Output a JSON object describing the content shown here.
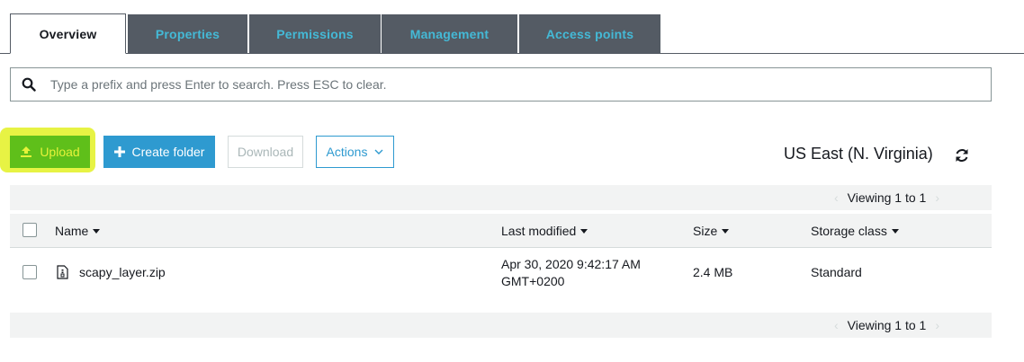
{
  "tabs": [
    {
      "label": "Overview",
      "active": true
    },
    {
      "label": "Properties"
    },
    {
      "label": "Permissions"
    },
    {
      "label": "Management"
    },
    {
      "label": "Access points"
    }
  ],
  "search": {
    "placeholder": "Type a prefix and press Enter to search. Press ESC to clear.",
    "value": ""
  },
  "toolbar": {
    "upload_label": "Upload",
    "create_folder_label": "Create folder",
    "download_label": "Download",
    "actions_label": "Actions"
  },
  "region": "US East (N. Virginia)",
  "pager": {
    "top": "Viewing 1 to 1",
    "bottom": "Viewing 1 to 1"
  },
  "table": {
    "columns": {
      "name": "Name",
      "last_modified": "Last modified",
      "size": "Size",
      "storage_class": "Storage class"
    },
    "rows": [
      {
        "name": "scapy_layer.zip",
        "last_modified_line1": "Apr 30, 2020 9:42:17 AM",
        "last_modified_line2": "GMT+0200",
        "size": "2.4 MB",
        "storage_class": "Standard"
      }
    ]
  },
  "colors": {
    "tab_bg": "#545b64",
    "tab_text": "#44b9d6",
    "primary": "#2e9ad0",
    "highlight": "#e6f23a"
  }
}
